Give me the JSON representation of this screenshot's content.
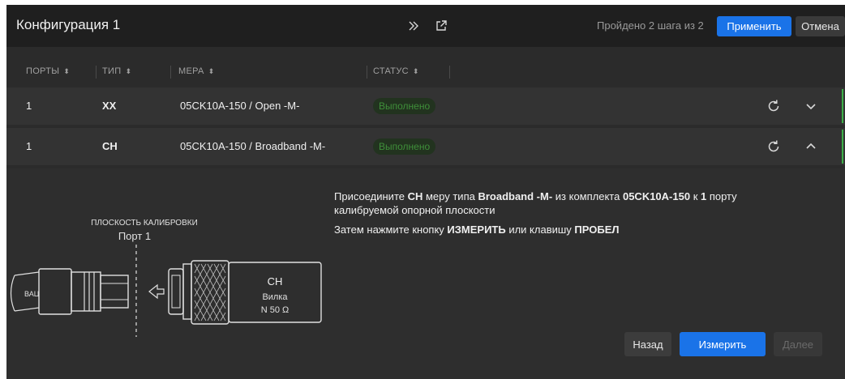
{
  "header": {
    "title": "Конфигурация 1",
    "progress": "Пройдено 2 шага из 2",
    "apply_label": "Применить",
    "cancel_label": "Отмена"
  },
  "columns": [
    {
      "label": "ПОРТЫ"
    },
    {
      "label": "ТИП"
    },
    {
      "label": "МЕРА"
    },
    {
      "label": "СТАТУС"
    }
  ],
  "rows": [
    {
      "port": "1",
      "type": "XX",
      "standard": "05CK10A-150 / Open -M-",
      "status": "Выполнено",
      "expanded": false
    },
    {
      "port": "1",
      "type": "CH",
      "standard": "05CK10A-150 / Broadband -M-",
      "status": "Выполнено",
      "expanded": true
    }
  ],
  "instruction": {
    "t1": "Присоедините ",
    "b1": "CH",
    "t2": "  меру типа ",
    "b2": "Broadband -M-",
    "t3": "  из комплекта ",
    "b3": "05CK10A-150",
    "t4": "  к ",
    "b4": "1",
    "t5": " порту калибруемой опорной плоскости",
    "line2_t1": "Затем нажмите кнопку ",
    "line2_b1": "ИЗМЕРИТЬ",
    "line2_t2": " или клавишу ",
    "line2_b2": "ПРОБЕЛ"
  },
  "diagram": {
    "plane_label": "ПЛОСКОСТЬ КАЛИБРОВКИ",
    "port_label": "Порт 1",
    "vna_label": "ВАЦ",
    "std_type": "CH",
    "std_gender": "Вилка",
    "std_connector": "N 50 Ω"
  },
  "footer": {
    "back_label": "Назад",
    "measure_label": "Измерить",
    "next_label": "Далее"
  },
  "colors": {
    "accent_blue": "#1a73e8",
    "status_green": "#3fae4a",
    "background": "#2b2b2b"
  }
}
